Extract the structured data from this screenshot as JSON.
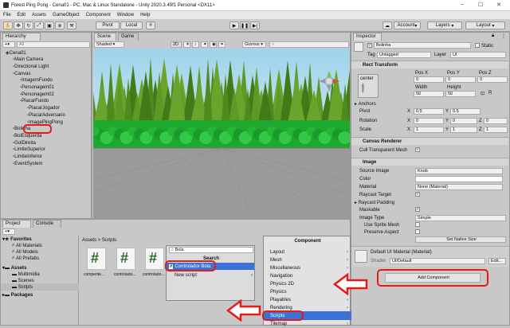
{
  "window": {
    "title": "Forest Ping Pong - Cena01 - PC, Mac & Linux Standalone - Unity 2020.3.49f1 Personal <DX11>",
    "minimize": "–",
    "maximize": "☐",
    "close": "✕"
  },
  "menu": [
    "File",
    "Edit",
    "Assets",
    "GameObject",
    "Component",
    "Window",
    "Help"
  ],
  "toolbar": {
    "pivot": "Pivot",
    "local": "Local",
    "account": "Account",
    "layers": "Layers",
    "layout": "Layout"
  },
  "hierarchy": {
    "tab": "Hierarchy",
    "search_placeholder": "All",
    "items": [
      {
        "label": "Cena01",
        "indent": 0
      },
      {
        "label": "Main Camera",
        "indent": 1
      },
      {
        "label": "Directional Light",
        "indent": 1
      },
      {
        "label": "Canvas",
        "indent": 1
      },
      {
        "label": "ImagemFundo",
        "indent": 2
      },
      {
        "label": "Personagem01",
        "indent": 2
      },
      {
        "label": "Personagem02",
        "indent": 2
      },
      {
        "label": "PlacarFundo",
        "indent": 2
      },
      {
        "label": "PlacarJogador",
        "indent": 3
      },
      {
        "label": "PlacarAdversario",
        "indent": 3
      },
      {
        "label": "ImagePingPong",
        "indent": 3
      },
      {
        "label": "Bolinha",
        "indent": 1
      },
      {
        "label": "BolEsquerda",
        "indent": 1
      },
      {
        "label": "GolDireita",
        "indent": 1
      },
      {
        "label": "LimiteSuperior",
        "indent": 1
      },
      {
        "label": "LimiteInferior",
        "indent": 1
      },
      {
        "label": "EventSystem",
        "indent": 1
      }
    ]
  },
  "scene": {
    "tab_scene": "Scene",
    "tab_game": "Game",
    "shaded": "Shaded",
    "mode": "2D",
    "gizmos": "Gizmos"
  },
  "project": {
    "tab_project": "Project",
    "tab_console": "Console",
    "favorites": "Favorites",
    "fav_items": [
      "All Materials",
      "All Models",
      "All Prefabs"
    ],
    "assets": "Assets",
    "asset_items": [
      "Multimidia",
      "Scenes",
      "Scripts"
    ],
    "packages": "Packages",
    "breadcrumb": "Assets > Scripts",
    "files": [
      "compente...",
      "controlado...",
      "controlado..."
    ]
  },
  "add_component_popup": {
    "search_value": "Bola",
    "search_label": "Search",
    "result": "Controlador Bola",
    "new_script": "New script"
  },
  "component_menu": {
    "title": "Component",
    "items": [
      "Layout",
      "Mesh",
      "Miscellaneous",
      "Navigation",
      "Physics 2D",
      "Physics",
      "Playables",
      "Rendering",
      "Scripts",
      "Tilemap"
    ],
    "selected": "Scripts"
  },
  "inspector": {
    "tab": "Inspector",
    "name": "Bolinha",
    "static_label": "Static",
    "tag_label": "Tag",
    "tag_value": "Untagged",
    "layer_label": "Layer",
    "layer_value": "UI",
    "rect": {
      "title": "Rect Transform",
      "anchor": "center",
      "middle": "middle",
      "posx_label": "Pos X",
      "posy_label": "Pos Y",
      "posz_label": "Pos Z",
      "posx": "0",
      "posy": "0",
      "posz": "0",
      "width_label": "Width",
      "height_label": "Height",
      "width": "50",
      "height": "50",
      "anchors": "Anchors",
      "pivot": "Pivot",
      "pivot_x": "0.5",
      "pivot_y": "0.5",
      "rotation": "Rotation",
      "rot_x": "0",
      "rot_y": "0",
      "rot_z": "0",
      "scale": "Scale",
      "scale_x": "1",
      "scale_y": "1",
      "scale_z": "1",
      "x": "X",
      "y": "Y",
      "z": "Z"
    },
    "canvas_renderer": {
      "title": "Canvas Renderer",
      "cull": "Cull Transparent Mesh"
    },
    "image": {
      "title": "Image",
      "source_image": "Source Image",
      "source_value": "Knob",
      "color": "Color",
      "material": "Material",
      "material_value": "None (Material)",
      "raycast_target": "Raycast Target",
      "raycast_padding": "Raycast Padding",
      "maskable": "Maskable",
      "image_type": "Image Type",
      "image_type_value": "Simple",
      "use_sprite_mesh": "Use Sprite Mesh",
      "preserve_aspect": "Preserve Aspect",
      "set_native": "Set Native Size"
    },
    "material": {
      "title": "Default UI Material (Material)",
      "shader_label": "Shader",
      "shader_value": "UI/Default",
      "edit": "Edit..."
    },
    "add_component": "Add Component"
  },
  "colors": {
    "highlight_red": "#e41b17",
    "selection_blue": "#3a72d8",
    "sky": "#acd9ec",
    "ground": "#1ea82e"
  }
}
